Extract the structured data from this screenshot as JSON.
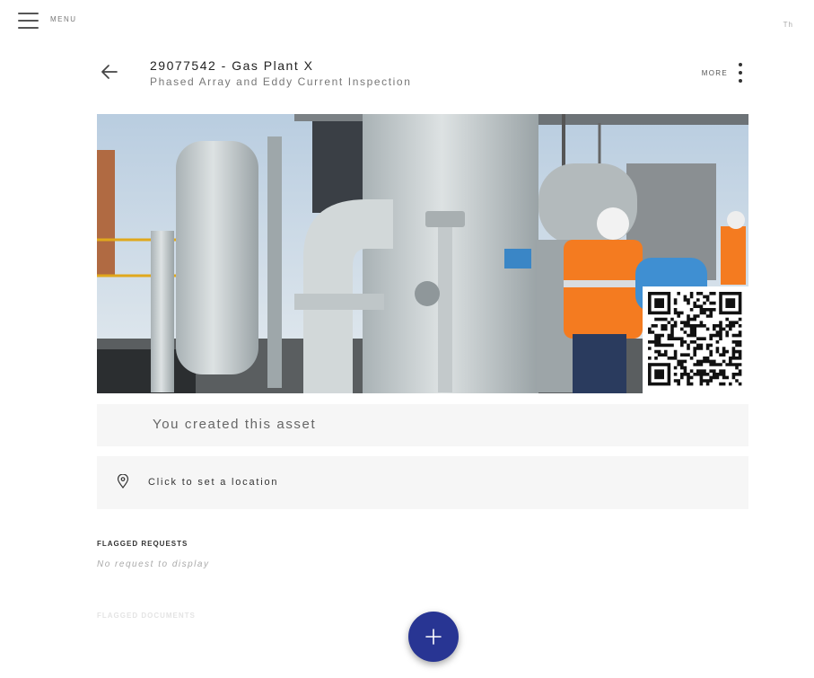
{
  "nav": {
    "menu_label": "MENU",
    "top_right_label": "Th",
    "more_label": "MORE"
  },
  "asset": {
    "title": "29077542 - Gas Plant X",
    "subtitle": "Phased Array and Eddy Current Inspection",
    "created_text": "You created this asset",
    "location_text": "Click to set a location"
  },
  "sections": {
    "flagged_requests_title": "FLAGGED REQUESTS",
    "flagged_requests_empty": "No request to display",
    "flagged_documents_title": "FLAGGED DOCUMENTS"
  },
  "icons": {
    "menu": "hamburger-icon",
    "back": "arrow-left-icon",
    "more": "more-vertical-icon",
    "location": "map-pin-icon",
    "fab": "plus-icon",
    "qr": "qr-code"
  },
  "colors": {
    "fab": "#283593",
    "panel": "#f6f6f6",
    "photo_sky": "#c9d8e6",
    "equipment": "#c8cfd2",
    "ppe_orange": "#f47b20"
  }
}
